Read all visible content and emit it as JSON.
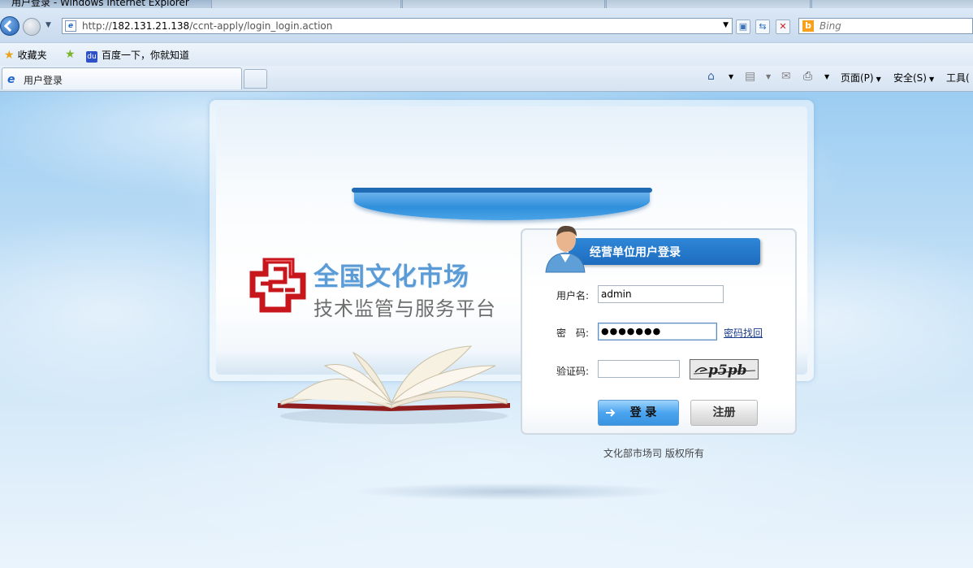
{
  "browser": {
    "window_title": "用户登录 - Windows Internet Explorer",
    "address_url_prefix": "http://",
    "address_url_host": "182.131.21.138",
    "address_url_path": "/ccnt-apply/login_login.action",
    "search_placeholder": "Bing",
    "favorites_label": "收藏夹",
    "favorite_link": "百度一下，你就知道",
    "tab_title": "用户登录",
    "command_bar": {
      "page_label": "页面(P)",
      "safety_label": "安全(S)",
      "tools_label": "工具("
    },
    "icons": [
      "back-icon",
      "forward-icon",
      "ie-icon",
      "compat-view-icon",
      "refresh-icon",
      "stop-icon",
      "bing-icon",
      "favorites-star-icon",
      "add-favorite-icon",
      "home-icon",
      "feeds-icon",
      "mail-icon",
      "print-icon"
    ]
  },
  "page": {
    "brand_line1": "全国文化市场",
    "brand_line2": "技术监管与服务平台",
    "login_title": "经营单位用户登录",
    "username_label": "用户名:",
    "username_value": "admin",
    "password_label": "密　码:",
    "password_value": "●●●●●●●",
    "forgot_password_link": "密码找回",
    "captcha_label": "验证码:",
    "captcha_value": "",
    "captcha_image_text": "p5pb",
    "login_button": "登 录",
    "register_button": "注册",
    "copyright": "文化部市场司  版权所有",
    "colors": {
      "brand_blue": "#5b9bd6",
      "logo_red": "#c8161d",
      "title_bar_blue": "#1d6cc0"
    }
  }
}
